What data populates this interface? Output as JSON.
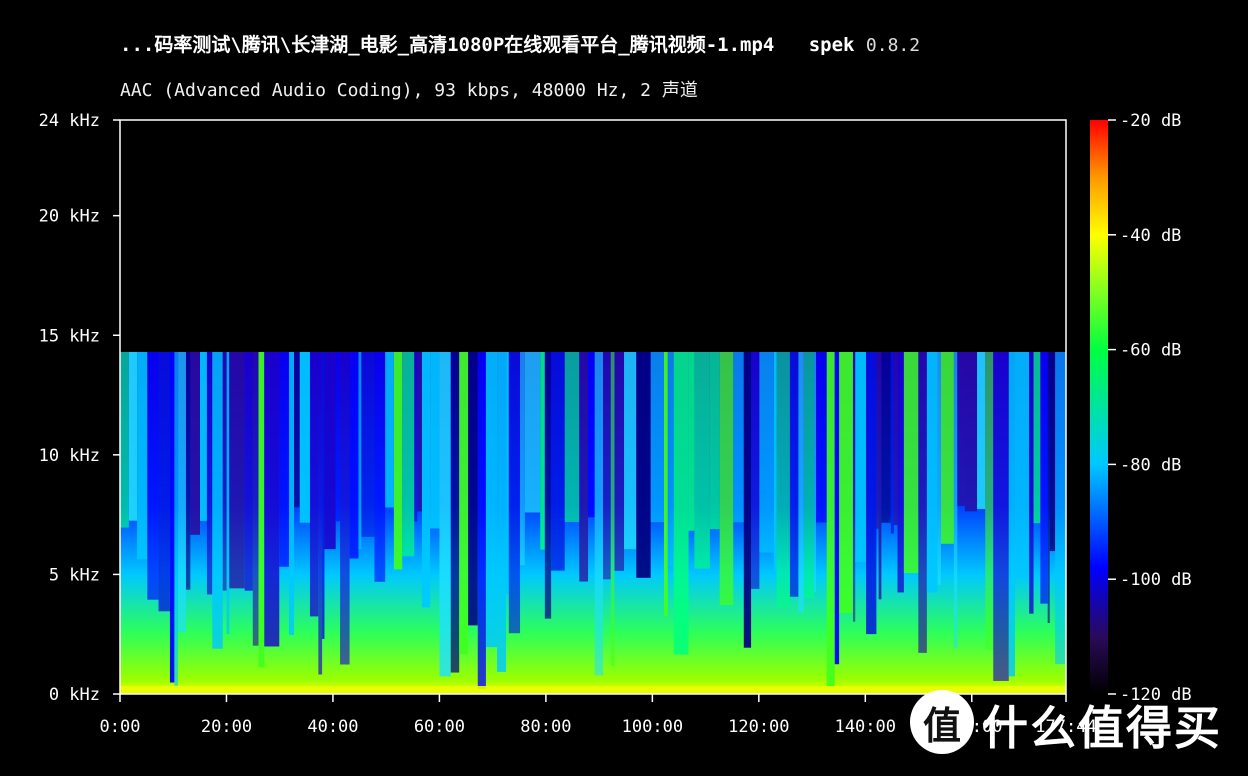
{
  "window": {
    "title_file": "...码率测试\\腾讯\\长津湖_电影_高清1080P在线观看平台_腾讯视频-1.mp4",
    "app_name": "spek",
    "app_version": "0.8.2",
    "subtitle": "AAC (Advanced Audio Coding), 93 kbps, 48000 Hz, 2 声道"
  },
  "watermark": {
    "logo_glyph": "值",
    "brand_text": "什么值得买"
  },
  "colors": {
    "background": "#000000",
    "axis": "#ffffff",
    "scale": [
      "#000000",
      "#2a0a5a",
      "#0000ff",
      "#00c8ff",
      "#00ff40",
      "#ffff00",
      "#ff9900",
      "#ff0000"
    ]
  },
  "chart_data": {
    "type": "heatmap",
    "title": "",
    "xlabel": "",
    "ylabel": "",
    "x_ticks": [
      "0:00",
      "20:00",
      "40:00",
      "60:00",
      "80:00",
      "100:00",
      "120:00",
      "140:00",
      "160:00",
      "177:44"
    ],
    "x_tick_values": [
      0,
      20,
      40,
      60,
      80,
      100,
      120,
      140,
      160,
      177.7
    ],
    "xlim": [
      0,
      177.7
    ],
    "y_ticks": [
      "0 kHz",
      "5 kHz",
      "10 kHz",
      "15 kHz",
      "20 kHz",
      "24 kHz"
    ],
    "y_tick_values": [
      0,
      5,
      10,
      15,
      20,
      24
    ],
    "ylim": [
      0,
      24
    ],
    "frequency_cutoff_khz": 14.3,
    "colorbar_ticks": [
      "-20 dB",
      "-40 dB",
      "-60 dB",
      "-80 dB",
      "-100 dB",
      "-120 dB"
    ],
    "colorbar_values": [
      -20,
      -40,
      -60,
      -80,
      -100,
      -120
    ],
    "colorbar_range": [
      -120,
      -20
    ],
    "grid": false,
    "legend": "right colorbar"
  }
}
